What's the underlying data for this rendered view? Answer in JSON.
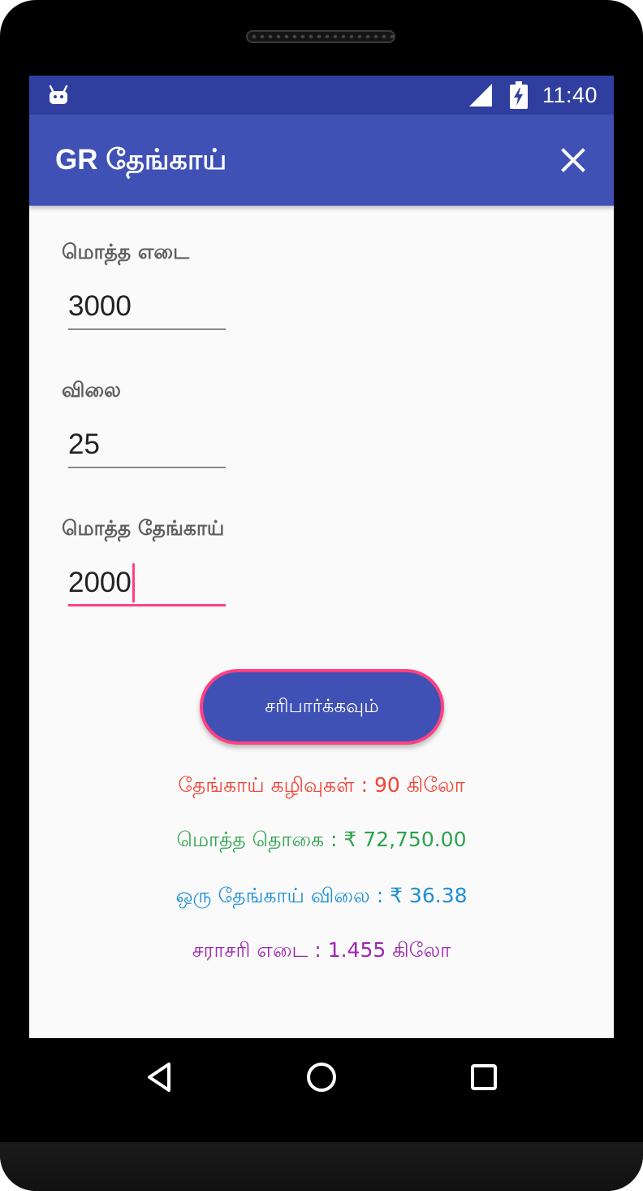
{
  "status_bar": {
    "time": "11:40",
    "icons": [
      "android-debug-icon",
      "cell-signal-icon",
      "battery-charging-icon"
    ]
  },
  "app_bar": {
    "title": "GR தேங்காய்",
    "close_icon": "close-icon"
  },
  "form": {
    "total_weight": {
      "label": "மொத்த எடை",
      "value": "3000"
    },
    "price": {
      "label": "விலை",
      "value": "25"
    },
    "total_coconut": {
      "label": "மொத்த தேங்காய்",
      "value": "2000"
    },
    "check_button_label": "சரிபார்க்கவும்"
  },
  "results": {
    "waste": "தேங்காய் கழிவுகள் : 90 கிலோ",
    "total_amount": "மொத்த தொகை : ₹ 72,750.00",
    "price_per_coconut": "ஒரு தேங்காய் விலை : ₹ 36.38",
    "average_weight": "சராசரி எடை : 1.455 கிலோ"
  },
  "colors": {
    "primary": "#3f51b5",
    "primary_dark": "#303f9f",
    "accent": "#ff4081",
    "waste": "#f44336",
    "total": "#2ea34f",
    "price": "#1e8fd5",
    "average": "#9c27b0"
  },
  "nav_bar": {
    "icons": [
      "back-icon",
      "home-icon",
      "recent-apps-icon"
    ]
  }
}
